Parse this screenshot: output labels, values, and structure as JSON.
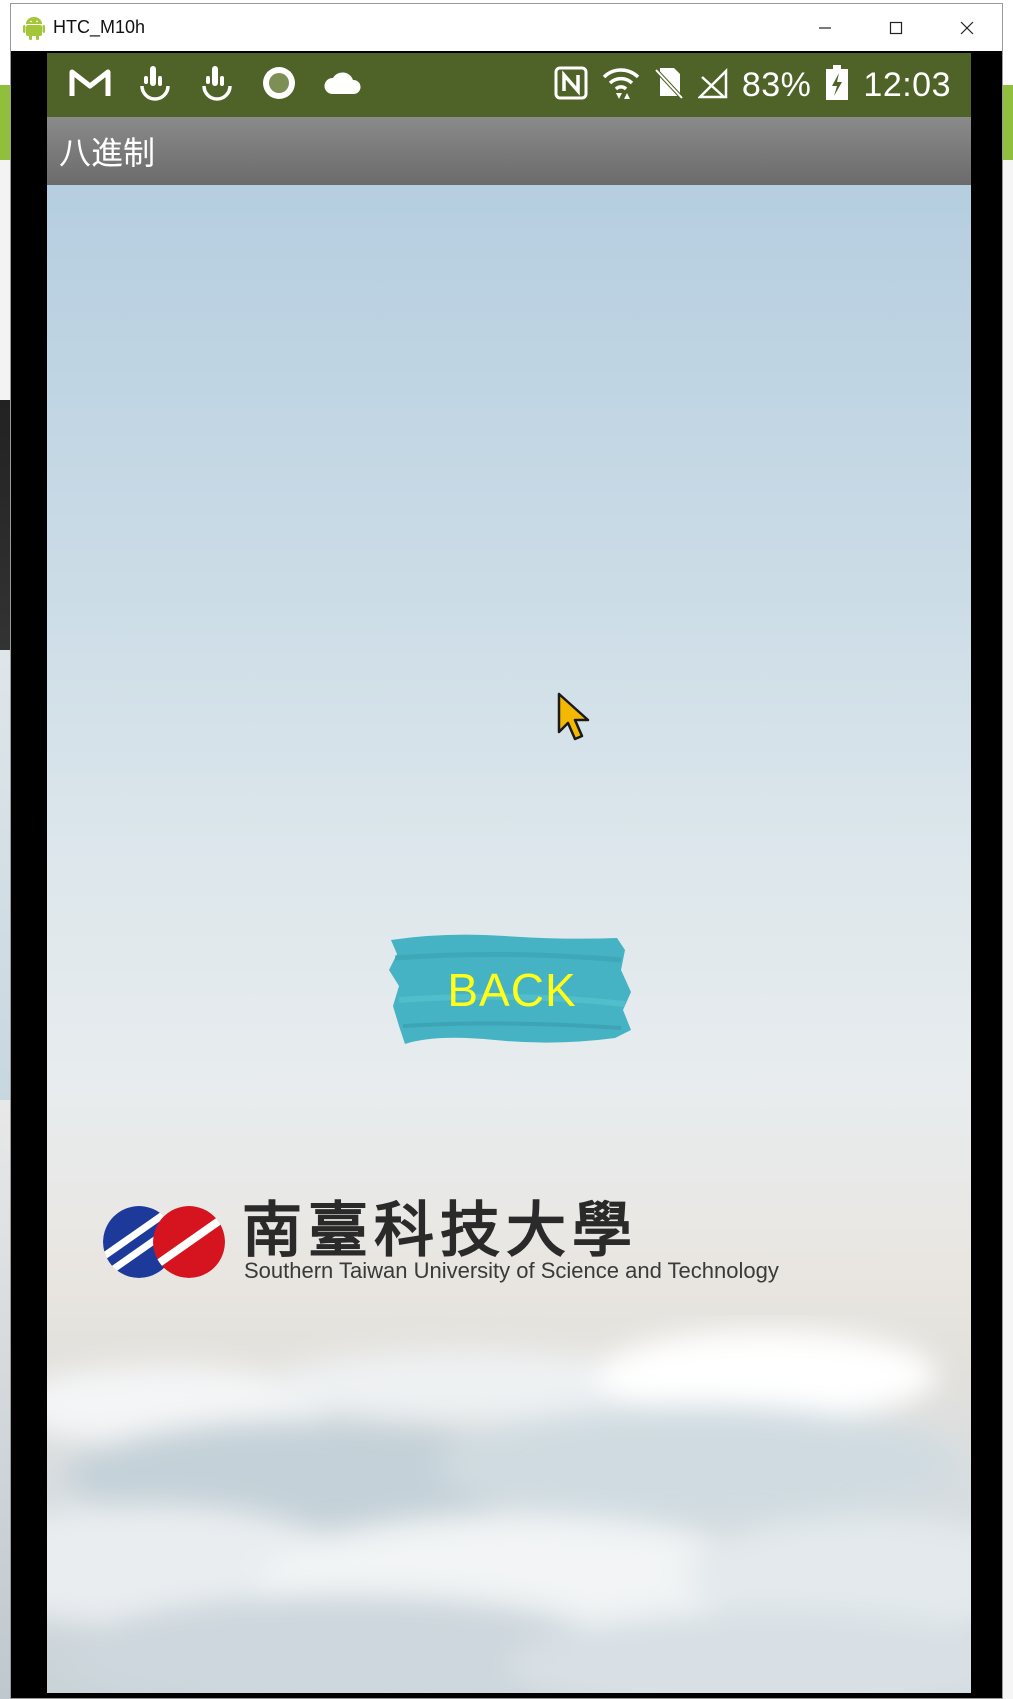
{
  "window": {
    "title": "HTC_M10h",
    "controls": [
      "minimize",
      "maximize",
      "close"
    ]
  },
  "statusbar": {
    "left_icons": [
      "gmail-icon",
      "touch-icon",
      "touch-icon",
      "circle-record-icon",
      "cloud-icon"
    ],
    "right_icons": [
      "nfc-icon",
      "wifi-icon",
      "no-sim-icon",
      "no-signal-icon"
    ],
    "battery": "83%",
    "time": "12:03"
  },
  "appbar": {
    "title": "八進制"
  },
  "main": {
    "back_label": "BACK",
    "back_color": "#45b3c3",
    "back_text_color": "#ffff1a"
  },
  "logo": {
    "name_zh": "南臺科技大學",
    "name_en": "Southern Taiwan University of Science and Technology",
    "colors": [
      "#1d3a9b",
      "#d6141f"
    ]
  },
  "colors": {
    "statusbar": "#4f6227",
    "appbar": "#7a7a7a"
  }
}
